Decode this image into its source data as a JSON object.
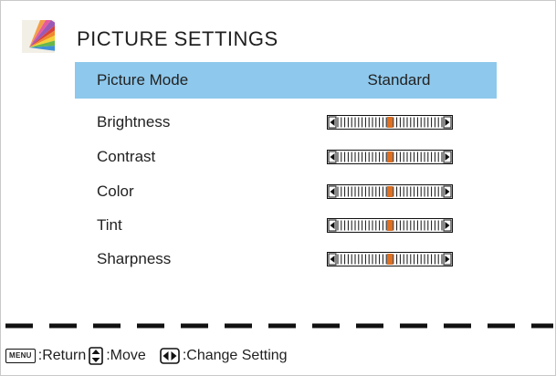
{
  "title": "PICTURE SETTINGS",
  "rows": [
    {
      "label": "Picture Mode",
      "value": "Standard"
    },
    {
      "label": "Brightness",
      "level": 0.5
    },
    {
      "label": "Contrast",
      "level": 0.5
    },
    {
      "label": "Color",
      "level": 0.5
    },
    {
      "label": "Tint",
      "level": 0.5
    },
    {
      "label": "Sharpness",
      "level": 0.5
    }
  ],
  "footer": {
    "menu_key": "MENU",
    "return_text": ":Return",
    "move_text": ":Move",
    "change_text": ":Change Setting"
  },
  "colors": {
    "selected_row": "#8ec8ec",
    "slider_marker": "#e06f1f"
  }
}
